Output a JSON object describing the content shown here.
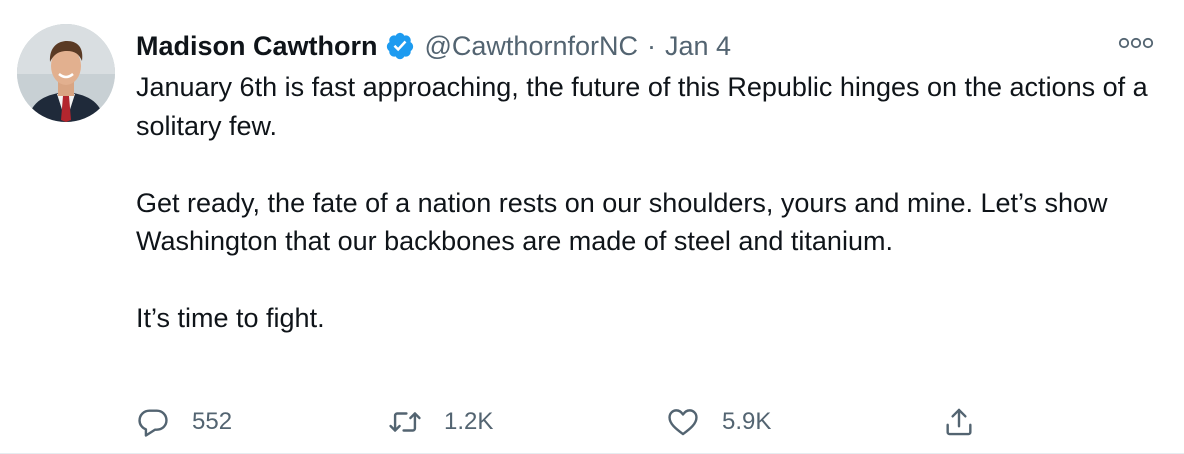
{
  "tweet": {
    "author": {
      "display_name": "Madison Cawthorn",
      "handle": "@CawthornforNC",
      "verified": true,
      "avatar_icon": "profile-photo"
    },
    "separator": "·",
    "date": "Jan 4",
    "more_icon": "more-options-icon",
    "paragraphs": [
      "January 6th is fast approaching, the future of this Republic hinges on the actions of a solitary few.",
      "Get ready, the fate of a nation rests on our shoulders, yours and mine. Let’s show Washington that our backbones are made of steel and titanium.",
      "It’s time to fight."
    ],
    "actions": {
      "reply_count": "552",
      "retweet_count": "1.2K",
      "like_count": "5.9K"
    }
  },
  "colors": {
    "text": "#0f1419",
    "secondary": "#536471",
    "verified_blue": "#1d9bf0"
  }
}
